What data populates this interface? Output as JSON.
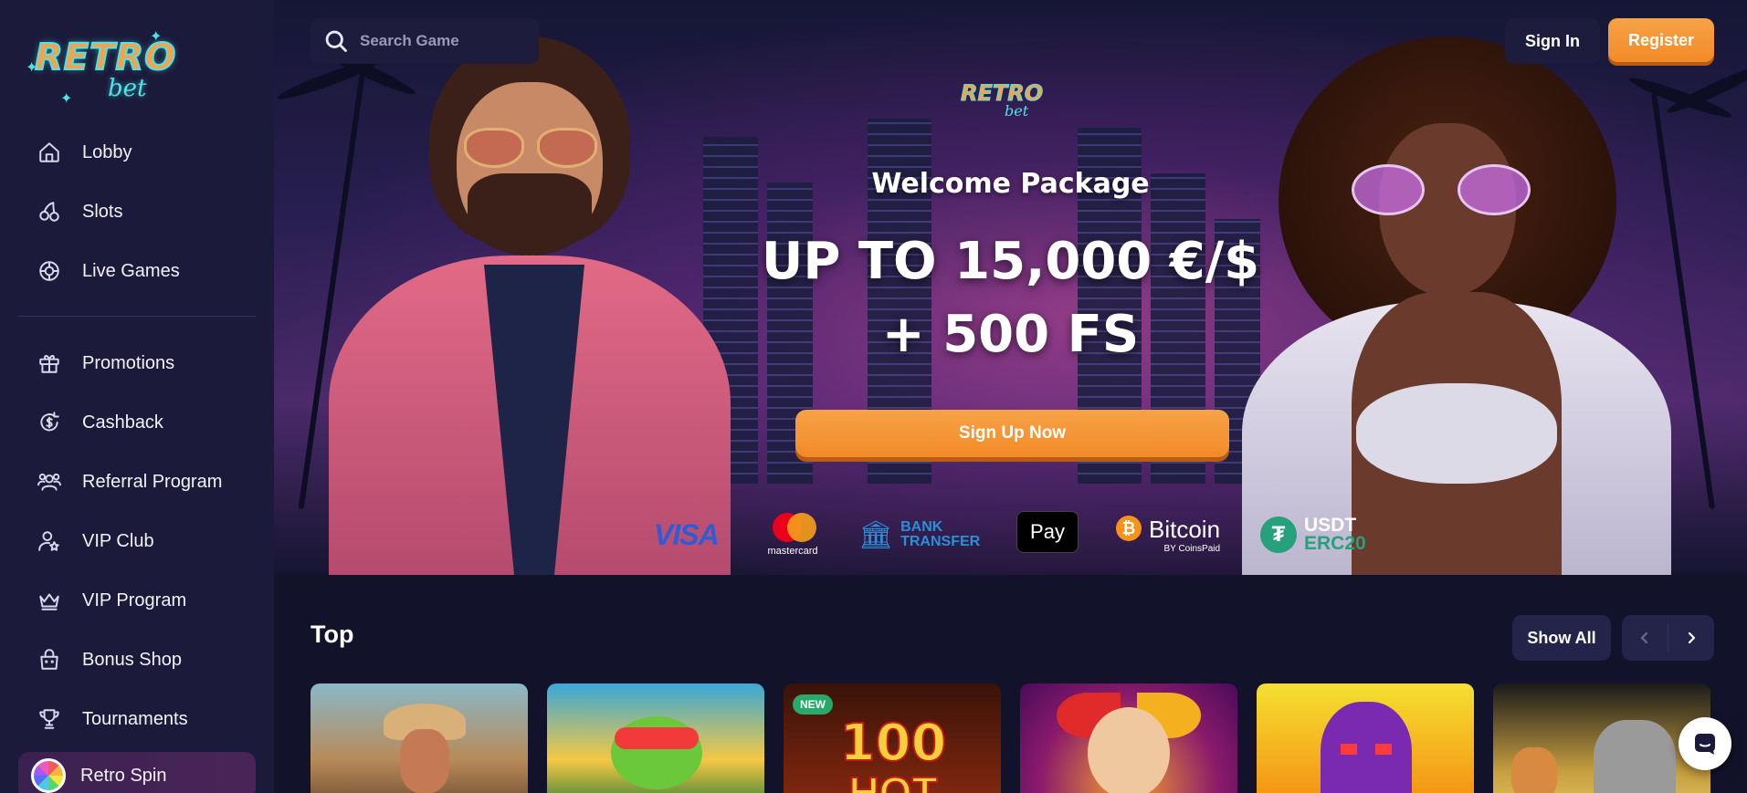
{
  "brand": {
    "logo_top": "RETRO",
    "logo_bottom": "bet",
    "accent": "#f28a28",
    "neon": "#4fe2e6"
  },
  "sidebar": {
    "items": [
      {
        "label": "Lobby",
        "icon": "home-icon"
      },
      {
        "label": "Slots",
        "icon": "cherry-icon"
      },
      {
        "label": "Live Games",
        "icon": "chip-icon"
      },
      {
        "label": "Promotions",
        "icon": "gift-icon"
      },
      {
        "label": "Cashback",
        "icon": "cashback-icon"
      },
      {
        "label": "Referral Program",
        "icon": "users-icon"
      },
      {
        "label": "VIP Club",
        "icon": "user-star-icon"
      },
      {
        "label": "VIP Program",
        "icon": "crown-icon"
      },
      {
        "label": "Bonus Shop",
        "icon": "shopping-bag-icon"
      },
      {
        "label": "Tournaments",
        "icon": "trophy-icon"
      },
      {
        "label": "Retro Spin",
        "icon": "spin-wheel-icon"
      }
    ]
  },
  "header": {
    "search_placeholder": "Search Game",
    "signin_label": "Sign In",
    "register_label": "Register"
  },
  "hero": {
    "logo_top": "RETRO",
    "logo_bottom": "bet",
    "welcome": "Welcome Package",
    "offer_line1": "UP TO 15,000 €/$",
    "offer_line2": "+ 500 FS",
    "cta": "Sign Up Now",
    "payments": {
      "visa": "VISA",
      "mastercard": "mastercard",
      "bank_line1": "BANK",
      "bank_line2": "TRANSFER",
      "applepay": "Pay",
      "bitcoin": "Bitcoin",
      "bitcoin_sub": "BY CoinsPaid",
      "usdt": "USDT",
      "usdt_sub": "ERC20"
    }
  },
  "top_section": {
    "title": "Top",
    "show_all": "Show All",
    "games": [
      {
        "badge": ""
      },
      {
        "badge": ""
      },
      {
        "badge": "NEW",
        "title_art": "100",
        "title_art2": "HOT"
      },
      {
        "badge": ""
      },
      {
        "badge": ""
      },
      {
        "badge": ""
      }
    ]
  }
}
